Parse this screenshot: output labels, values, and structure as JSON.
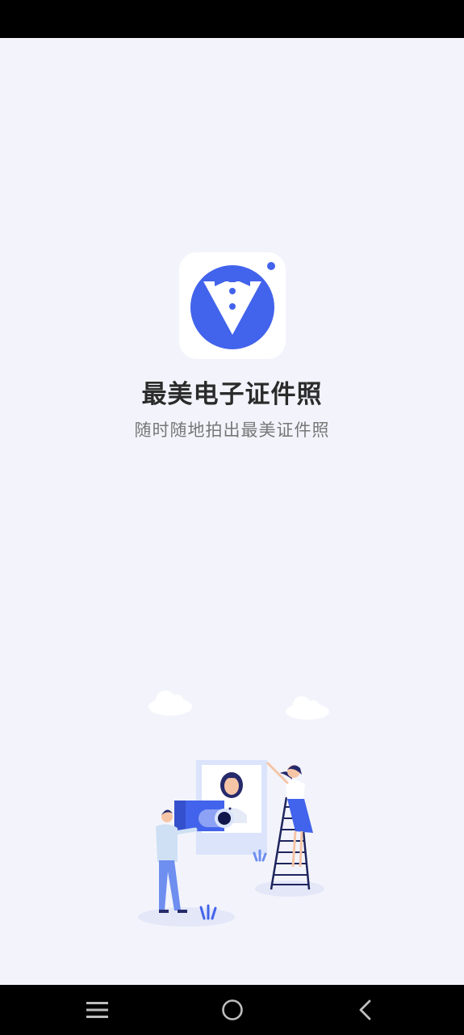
{
  "app": {
    "title": "最美电子证件照",
    "slogan": "随时随地拍出最美证件照"
  },
  "icons": {
    "logo": "tuxedo-bowtie-logo-icon",
    "illustration": "photographer-id-photo-illustration",
    "nav_menu": "menu-icon",
    "nav_home": "home-circle-icon",
    "nav_back": "back-chevron-icon"
  },
  "colors": {
    "background": "#f3f4fb",
    "brand_blue": "#4263eb",
    "title": "#2b2b2b",
    "slogan": "#777777",
    "system_bar": "#000000"
  }
}
